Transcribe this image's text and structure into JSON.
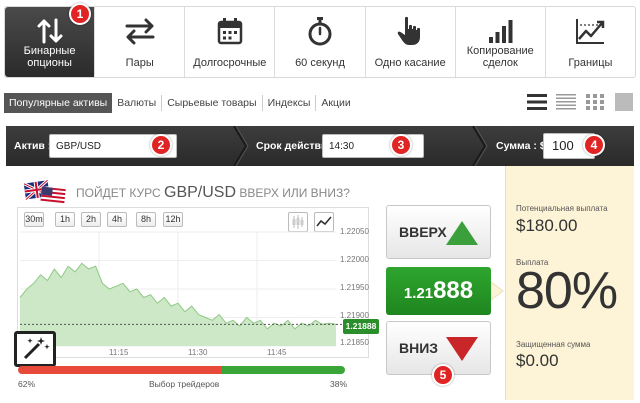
{
  "nav": {
    "items": [
      {
        "label": "Бинарные\nопционы",
        "icon": "arrows-up-down-icon",
        "active": true
      },
      {
        "label": "Пары",
        "icon": "arrows-left-right-icon"
      },
      {
        "label": "Долгосрочные",
        "icon": "calendar-icon"
      },
      {
        "label": "60 секунд",
        "icon": "stopwatch-icon"
      },
      {
        "label": "Одно касание",
        "icon": "hand-pointer-icon"
      },
      {
        "label": "Копирование\nсделок",
        "icon": "signal-bars-icon"
      },
      {
        "label": "Границы",
        "icon": "chart-line-icon"
      }
    ]
  },
  "badges": [
    "1",
    "2",
    "3",
    "4",
    "5"
  ],
  "categories": {
    "items": [
      "Популярные активы",
      "Валюты",
      "Сырьевые товары",
      "Индексы",
      "Акции"
    ],
    "active": 0
  },
  "form": {
    "asset_label": "Актив :",
    "asset_value": "GBP/USD",
    "expiry_label": "Срок действия :",
    "expiry_value": "14:30",
    "amount_label": "Сумма : $",
    "amount_value": "100"
  },
  "question": {
    "prefix": "ПОЙДЕТ КУРС",
    "pair": "GBP/USD",
    "suffix": "ВВЕРХ ИЛИ ВНИЗ?"
  },
  "timeframes": [
    "30m",
    "1h",
    "2h",
    "4h",
    "8h",
    "12h"
  ],
  "chart_data": {
    "type": "area",
    "y_ticks": [
      "1.22050",
      "1.22000",
      "1.21950",
      "1.21900",
      "1.21850"
    ],
    "x_ticks": [
      "11:15",
      "11:30",
      "11:45"
    ],
    "ylim": [
      1.2185,
      1.2205
    ],
    "current_price": "1.21888",
    "values": [
      1.21935,
      1.2195,
      1.2196,
      1.21975,
      1.21965,
      1.21985,
      1.2197,
      1.2199,
      1.2198,
      1.21995,
      1.21985,
      1.2199,
      1.2196,
      1.2195,
      1.21955,
      1.2196,
      1.21945,
      1.2195,
      1.21935,
      1.2194,
      1.21925,
      1.21935,
      1.2192,
      1.21925,
      1.2191,
      1.2192,
      1.21905,
      1.219,
      1.21895,
      1.21905,
      1.2189,
      1.21895,
      1.21885,
      1.219,
      1.2189,
      1.21895,
      1.2188,
      1.2189,
      1.21885,
      1.21895,
      1.2188,
      1.2189,
      1.21885,
      1.21895,
      1.21888,
      1.2189,
      1.21888
    ]
  },
  "sentiment": {
    "left_pct": "62%",
    "label": "Выбор трейдеров",
    "right_pct": "38%",
    "left_fraction": 0.62,
    "left_color": "#e84a3a",
    "right_color": "#3aa63a"
  },
  "buttons": {
    "up": "ВВЕРХ",
    "down": "ВНИЗ",
    "price_small": "1.21",
    "price_big": "888"
  },
  "payout": {
    "potential_label": "Потенциальная выплата",
    "potential_value": "$180.00",
    "payout_label": "Выплата",
    "payout_value": "80%",
    "protected_label": "Защищенная сумма",
    "protected_value": "$0.00"
  },
  "colors": {
    "accent_red": "#e02323",
    "green": "#2a8f2a",
    "panel_bg": "#fdf3d7"
  }
}
